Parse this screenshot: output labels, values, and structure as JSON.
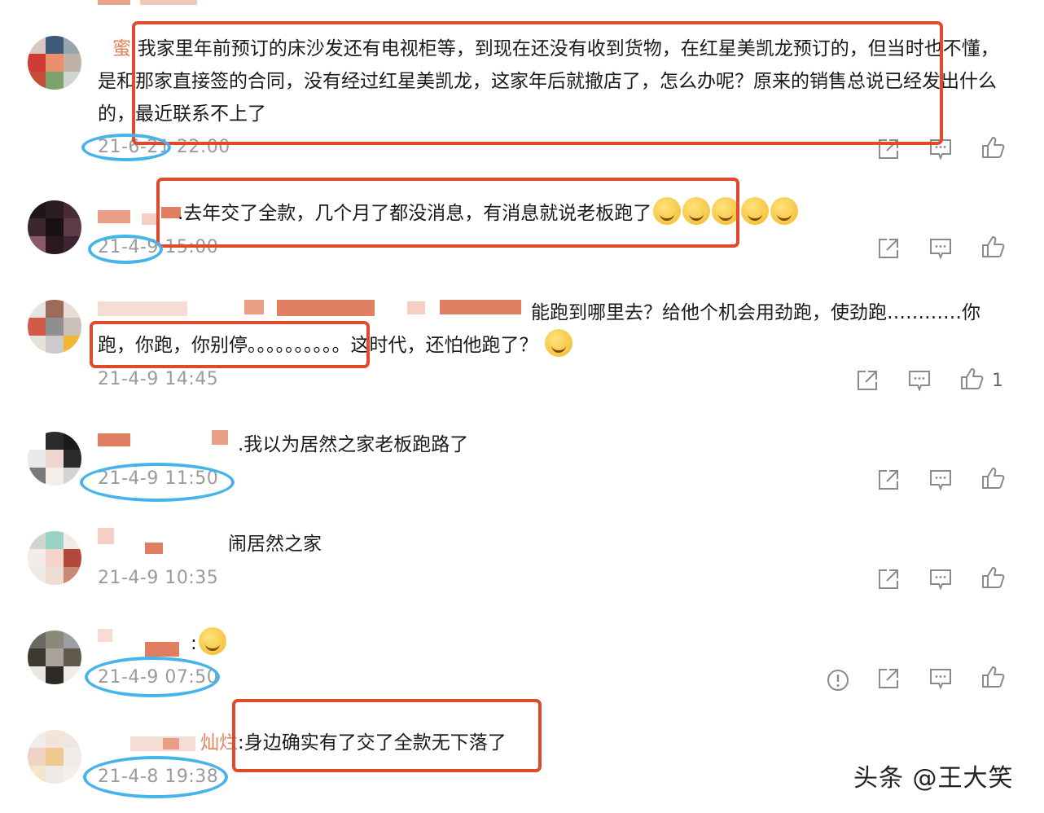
{
  "comments": [
    {
      "name_fragment": "蜜",
      "text": ":我家里年前预订的床沙发还有电视柜等，到现在还没有收到货物，在红星美凯龙预订的，但当时也不懂，是和那家直接签的合同，没有经过红星美凯龙，这家年后就撤店了，怎么办呢？原来的销售总说已经发出什么的，最近联系不上了",
      "time": "21-6-21 22:00"
    },
    {
      "name_fragment": "",
      "text": ".去年交了全款，几个月了都没消息，有消息就说老板跑了",
      "time": "21-4-9 15:00"
    },
    {
      "name_fragment": "",
      "text_line1": "能跑到哪里去？给他个机会用劲跑，使劲跑…………你",
      "text_line2": "跑，你跑，你别停。。。。。。。。。。这时代，还怕他跑了？",
      "time": "21-4-9 14:45",
      "likes": "1"
    },
    {
      "name_fragment": "",
      "text": ".我以为居然之家老板跑路了",
      "time": "21-4-9 11:50"
    },
    {
      "name_fragment": "",
      "text": "闹居然之家",
      "time": "21-4-9 10:35"
    },
    {
      "name_fragment": "",
      "text": ":",
      "time": "21-4-9 07:50"
    },
    {
      "name_fragment": "灿烂",
      "text": ":身边确实有了交了全款无下落了",
      "time": "21-4-8 19:38"
    }
  ],
  "actions": {
    "share": "share-icon",
    "reply": "comment-icon",
    "like": "thumbs-up-icon",
    "report": "report-icon"
  },
  "watermark": "头条 @王大笑",
  "colors": {
    "highlight_box": "#e0492c",
    "highlight_oval": "#45b4ea",
    "username": "#e0825e",
    "timestamp": "#9b9b9b"
  }
}
